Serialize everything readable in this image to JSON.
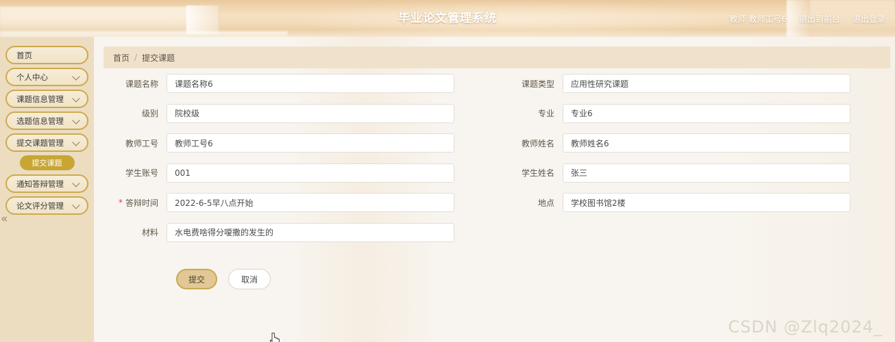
{
  "header": {
    "title": "毕业论文管理系统",
    "user_role_name": "教师 教师工号6",
    "exit_front_label": "退出到前台",
    "logout_label": "退出登录"
  },
  "sidebar": {
    "collapse_icon": "«",
    "items": [
      {
        "label": "首页",
        "has_chevron": false,
        "expanded": false
      },
      {
        "label": "个人中心",
        "has_chevron": true,
        "expanded": false
      },
      {
        "label": "课题信息管理",
        "has_chevron": true,
        "expanded": false
      },
      {
        "label": "选题信息管理",
        "has_chevron": true,
        "expanded": false
      },
      {
        "label": "提交课题管理",
        "has_chevron": true,
        "expanded": true
      },
      {
        "label": "通知答辩管理",
        "has_chevron": true,
        "expanded": false
      },
      {
        "label": "论文评分管理",
        "has_chevron": true,
        "expanded": false
      }
    ],
    "submenu": [
      {
        "label": "提交课题",
        "active": true
      }
    ]
  },
  "breadcrumb": {
    "home": "首页",
    "separator": "/",
    "current": "提交课题"
  },
  "form": {
    "fields_left": [
      {
        "label": "课题名称",
        "value": "课题名称6",
        "required": false
      },
      {
        "label": "级别",
        "value": "院校级",
        "required": false
      },
      {
        "label": "教师工号",
        "value": "教师工号6",
        "required": false
      },
      {
        "label": "学生账号",
        "value": "001",
        "required": false
      },
      {
        "label": "答辩时间",
        "value": "2022-6-5早八点开始",
        "required": true
      },
      {
        "label": "材料",
        "value": "水电费啥得分嗄撒的发生的",
        "required": false
      }
    ],
    "fields_right": [
      {
        "label": "课题类型",
        "value": "应用性研究课题",
        "required": false
      },
      {
        "label": "专业",
        "value": "专业6",
        "required": false
      },
      {
        "label": "教师姓名",
        "value": "教师姓名6",
        "required": false
      },
      {
        "label": "学生姓名",
        "value": "张三",
        "required": false
      },
      {
        "label": "地点",
        "value": "学校图书馆2楼",
        "required": false
      }
    ],
    "submit_label": "提交",
    "cancel_label": "取消"
  },
  "watermark": "CSDN @Zlq2024_",
  "colors": {
    "accent_gold": "#c8a634",
    "border_gold": "#cbaa4e",
    "header_tan": "#f0d5ae",
    "sidebar_bg": "#ecddc1",
    "breadcrumb_bg": "#f0e2ca",
    "required_red": "#e4393c"
  }
}
